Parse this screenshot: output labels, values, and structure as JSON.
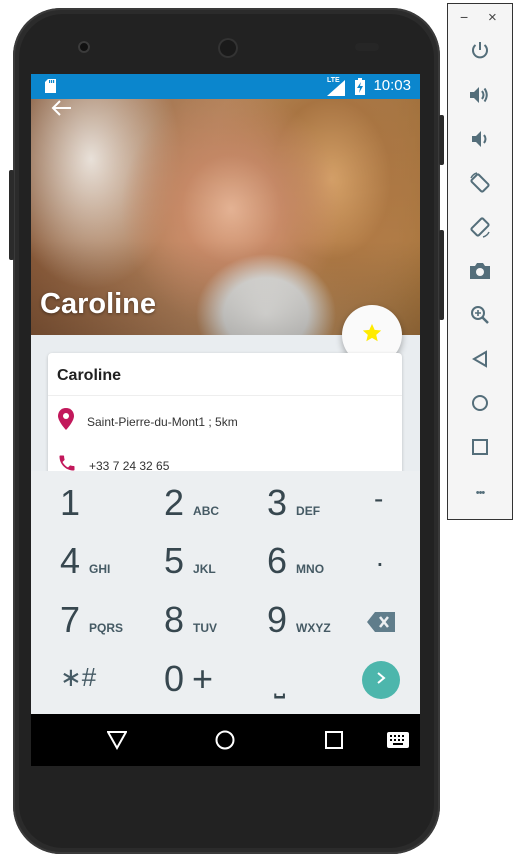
{
  "status_bar": {
    "time": "10:03",
    "network": "LTE"
  },
  "contact": {
    "hero_name": "Caroline",
    "card_name": "Caroline",
    "address": "Saint-Pierre-du-Mont1 ; 5km",
    "phone": "+33 7 24 32 65"
  },
  "keypad": {
    "keys": [
      {
        "num": "1",
        "sub": ""
      },
      {
        "num": "2",
        "sub": "ABC"
      },
      {
        "num": "3",
        "sub": "DEF"
      },
      {
        "num": "-",
        "sub": ""
      },
      {
        "num": "4",
        "sub": "GHI"
      },
      {
        "num": "5",
        "sub": "JKL"
      },
      {
        "num": "6",
        "sub": "MNO"
      },
      {
        "num": ".",
        "sub": ""
      },
      {
        "num": "7",
        "sub": "PQRS"
      },
      {
        "num": "8",
        "sub": "TUV"
      },
      {
        "num": "9",
        "sub": "WXYZ"
      },
      {
        "num": "0",
        "sub": "+"
      }
    ],
    "star_hash": "∗#",
    "space": "⎵"
  },
  "emulator_panel": {
    "minimize": "−",
    "close": "×",
    "more": "•••"
  },
  "colors": {
    "status_bar": "#0b86cd",
    "accent_pink": "#c2185b",
    "fab_star": "#ffeb00",
    "go_button": "#4db6ac"
  }
}
